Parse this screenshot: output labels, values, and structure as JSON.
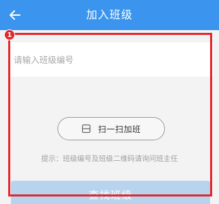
{
  "header": {
    "title": "加入班级",
    "back_icon": "arrow-left-icon"
  },
  "form": {
    "class_code_value": "",
    "class_code_placeholder": "请输入班级编号",
    "scan_icon": "scan-icon",
    "scan_button_label": "扫一扫加班",
    "hint": "提示：班级编号及班级二维码请询问班主任",
    "search_button_label": "查找班级"
  },
  "annotation": {
    "badge_number": "1",
    "color": "#e4262a"
  },
  "colors": {
    "header_bg": "#3b95ee",
    "search_button_bg": "#b7d3ee",
    "page_bg": "#f3f3f3"
  }
}
